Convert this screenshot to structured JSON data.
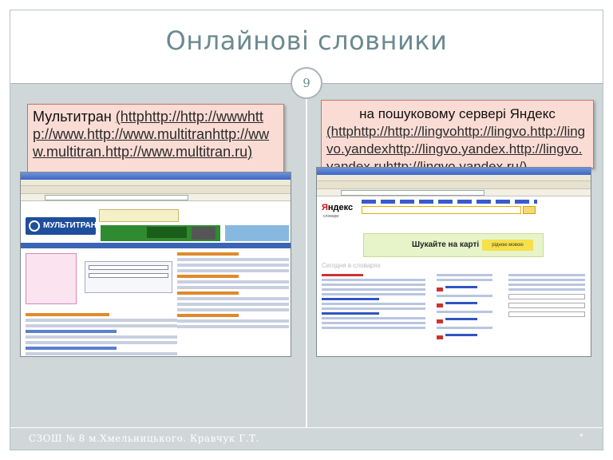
{
  "slide": {
    "title": "Онлайнові словники",
    "number": "9",
    "footer": "СЗОШ № 8 м.Хмельницького.  Кравчук Г.Т.",
    "footer_mark": "*"
  },
  "left_callout": {
    "name": "Мультитран",
    "link_text": "(httphttp://http://wwwhttp://www.http://www.multitranhttp://www.multitran.http://www.multitran.ru)"
  },
  "right_callout": {
    "lead": "на пошуковому сервері Яндекс",
    "link_text": "(httphttp://http://lingvohttp://lingvo.http://lingvo.yandexhttp://lingvo.yandex.http://lingvo.yandex.ruhttp://lingvo.yandex.ru/)"
  },
  "multitran_shot": {
    "logo": "МУЛЬТИТРАН"
  },
  "yandex_shot": {
    "logo_red": "Я",
    "logo_rest": "ндекс",
    "logo_sub": "словари",
    "banner_text": "Шукайте на карті",
    "banner_button": "рідною мовою",
    "section_heading": "Сегодня в словарях"
  }
}
